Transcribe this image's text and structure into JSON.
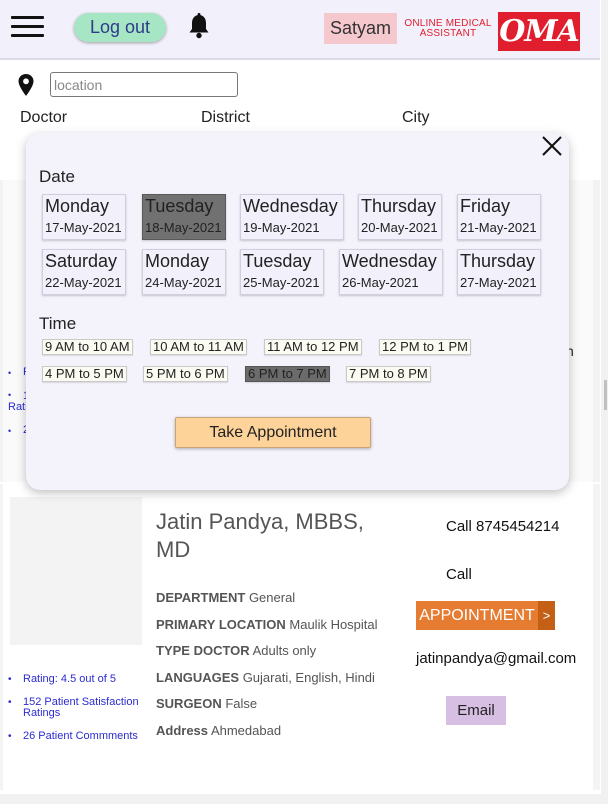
{
  "header": {
    "logout_label": "Log out",
    "user_name": "Satyam",
    "brand_tagline": "ONLINE MEDICAL ASSISTANT",
    "brand_logo": "OMA",
    "icons": [
      "menu-icon",
      "bell-icon"
    ]
  },
  "search": {
    "location_placeholder": "location",
    "filters": [
      "Doctor",
      "District",
      "City"
    ]
  },
  "background_card": {
    "peek_items": [
      "R",
      "1",
      "Rati",
      "2"
    ],
    "peek_right_text": "n"
  },
  "modal": {
    "date_label": "Date",
    "time_label": "Time",
    "dates": [
      {
        "day": "Monday",
        "date": "17-May-2021",
        "selected": false
      },
      {
        "day": "Tuesday",
        "date": "18-May-2021",
        "selected": true
      },
      {
        "day": "Wednesday",
        "date": "19-May-2021",
        "selected": false
      },
      {
        "day": "Thursday",
        "date": "20-May-2021",
        "selected": false
      },
      {
        "day": "Friday",
        "date": "21-May-2021",
        "selected": false
      },
      {
        "day": "Saturday",
        "date": "22-May-2021",
        "selected": false
      },
      {
        "day": "Monday",
        "date": "24-May-2021",
        "selected": false
      },
      {
        "day": "Tuesday",
        "date": "25-May-2021",
        "selected": false
      },
      {
        "day": "Wednesday",
        "date": "26-May-2021",
        "selected": false
      },
      {
        "day": "Thursday",
        "date": "27-May-2021",
        "selected": false
      }
    ],
    "times": [
      {
        "label": "9 AM to 10 AM",
        "selected": false
      },
      {
        "label": "10 AM to 11 AM",
        "selected": false
      },
      {
        "label": "11 AM to 12 PM",
        "selected": false
      },
      {
        "label": "12 PM to 1 PM",
        "selected": false
      },
      {
        "label": "4 PM to 5 PM",
        "selected": false
      },
      {
        "label": "5 PM to 6 PM",
        "selected": false
      },
      {
        "label": "6 PM to 7 PM",
        "selected": true
      },
      {
        "label": "7 PM to 8 PM",
        "selected": false
      }
    ],
    "take_appointment_label": "Take Appointment"
  },
  "doctor": {
    "name": "Jatin Pandya, MBBS, MD",
    "ratings": {
      "rating": "Rating: 4.5 out of 5",
      "satisfaction": "152 Patient Satisfaction Ratings",
      "comments": "26 Patient Commments"
    },
    "details": [
      {
        "key": "DEPARTMENT",
        "value": "General"
      },
      {
        "key": "PRIMARY LOCATION",
        "value": "Maulik Hospital"
      },
      {
        "key": "TYPE DOCTOR",
        "value": "Adults only"
      },
      {
        "key": "LANGUAGES",
        "value": "Gujarati, English, Hindi"
      },
      {
        "key": "SURGEON",
        "value": "False"
      },
      {
        "key": "Address",
        "value": "Ahmedabad"
      }
    ],
    "call_number": "Call 8745454214",
    "call_label": "Call",
    "appointment_label": "APPOINTMENT",
    "appointment_arrow": ">",
    "email": "jatinpandya@gmail.com",
    "email_label": "Email"
  },
  "colors": {
    "header_bg": "#f2f1fb",
    "logout_bg": "#a6e6c4",
    "user_badge_bg": "#f4c8cc",
    "brand_red": "#e01e2d",
    "appointment_orange": "#e57c31",
    "email_btn_bg": "#d7bfe4",
    "take_btn_bg": "#fdd39a",
    "selected_gray": "#717171",
    "rating_link": "#2b2bd1"
  }
}
